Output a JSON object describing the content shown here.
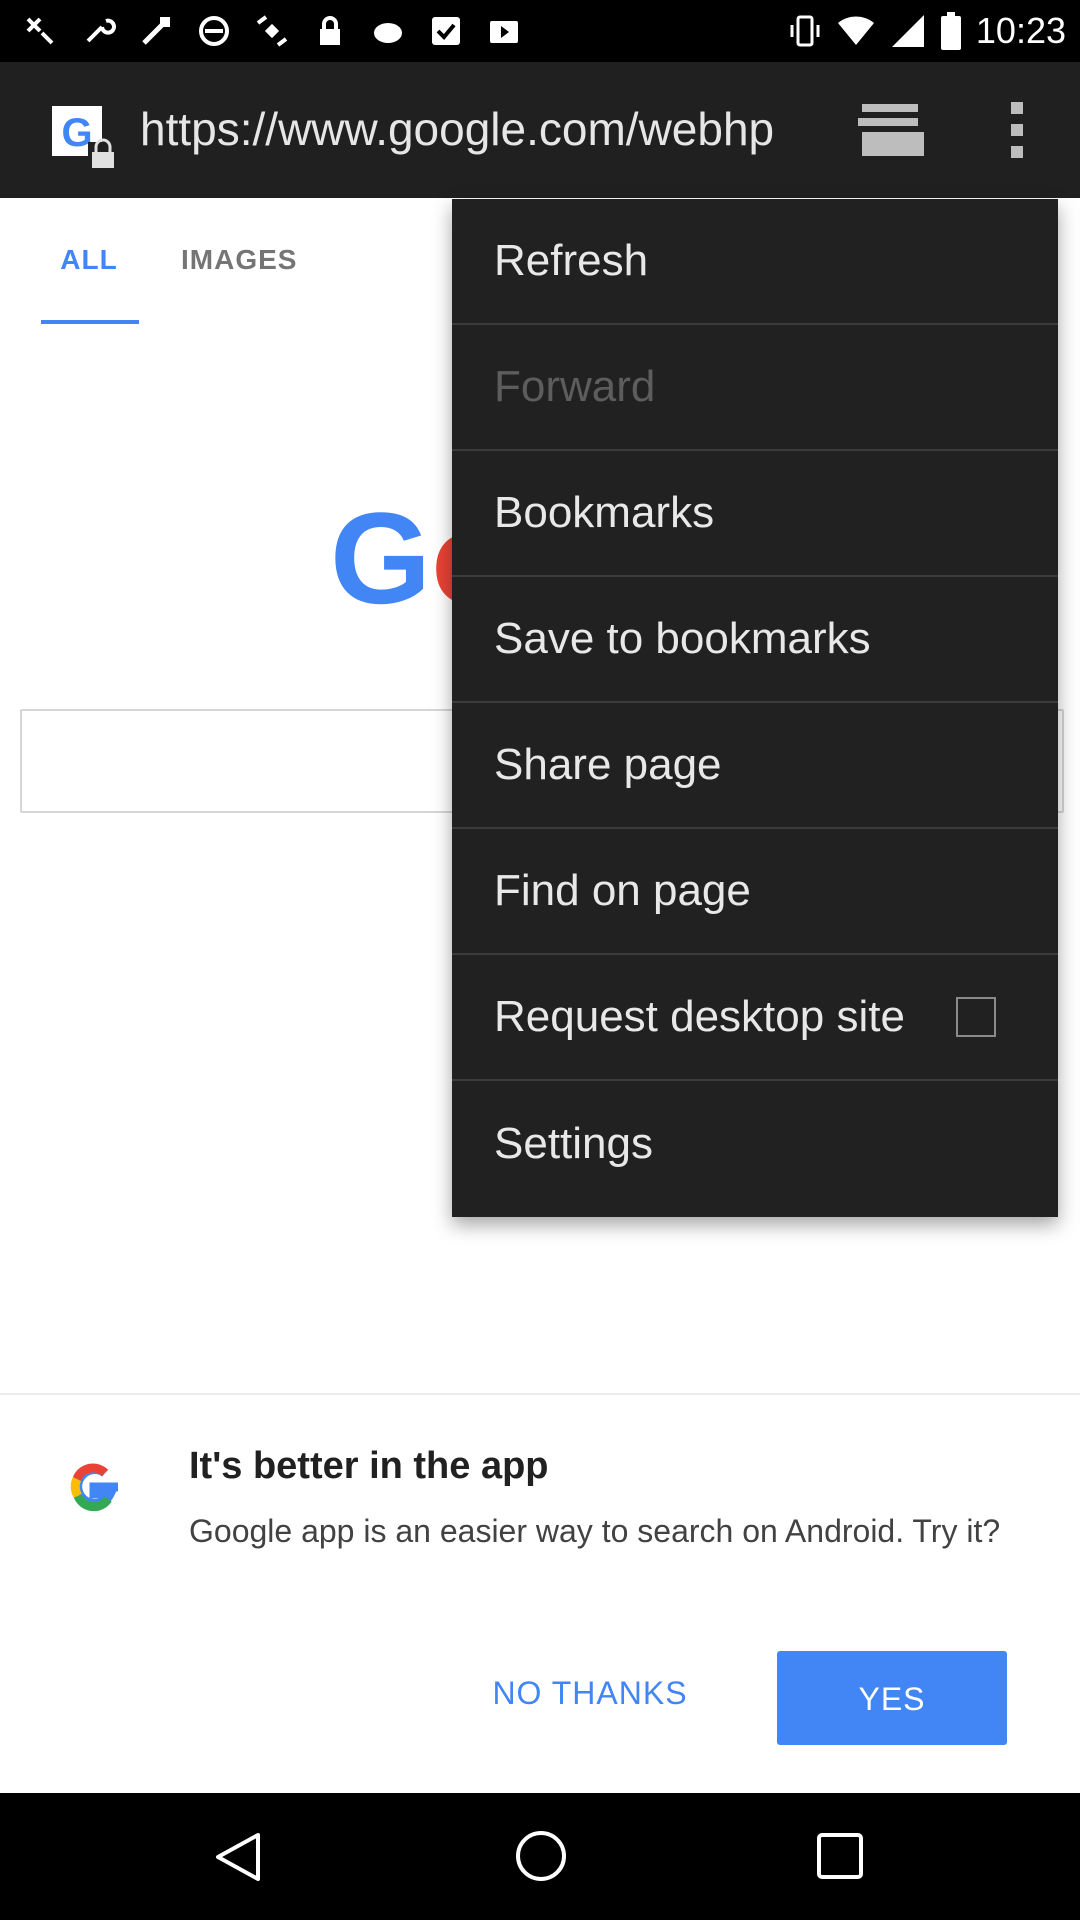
{
  "status_bar": {
    "time": "10:23",
    "left_icons": [
      "notification-icon",
      "wrench-icon",
      "tools-icon",
      "block-icon",
      "satellite-icon",
      "lock-icon",
      "cloud-icon",
      "check-box-icon",
      "play-store-icon"
    ],
    "right_icons": [
      "vibrate-icon",
      "wifi-icon",
      "cell-signal-icon",
      "battery-icon"
    ]
  },
  "toolbar": {
    "url": "https://www.google.com/webhp"
  },
  "page": {
    "tabs": [
      {
        "label": "ALL",
        "selected": true
      },
      {
        "label": "IMAGES",
        "selected": false
      }
    ]
  },
  "menu": {
    "items": [
      {
        "label": "Refresh",
        "enabled": true
      },
      {
        "label": "Forward",
        "enabled": false
      },
      {
        "label": "Bookmarks",
        "enabled": true
      },
      {
        "label": "Save to bookmarks",
        "enabled": true
      },
      {
        "label": "Share page",
        "enabled": true
      },
      {
        "label": "Find on page",
        "enabled": true
      },
      {
        "label": "Request desktop site",
        "enabled": true,
        "checked": false
      },
      {
        "label": "Settings",
        "enabled": true
      }
    ]
  },
  "promo": {
    "title": "It's better in the app",
    "body": "Google app is an easier way to search on Android. Try it?",
    "no_thanks_label": "NO THANKS",
    "yes_label": "YES"
  },
  "colors": {
    "accent": "#4285f4",
    "menu_bg": "#212121",
    "toolbar_bg": "#202020"
  }
}
